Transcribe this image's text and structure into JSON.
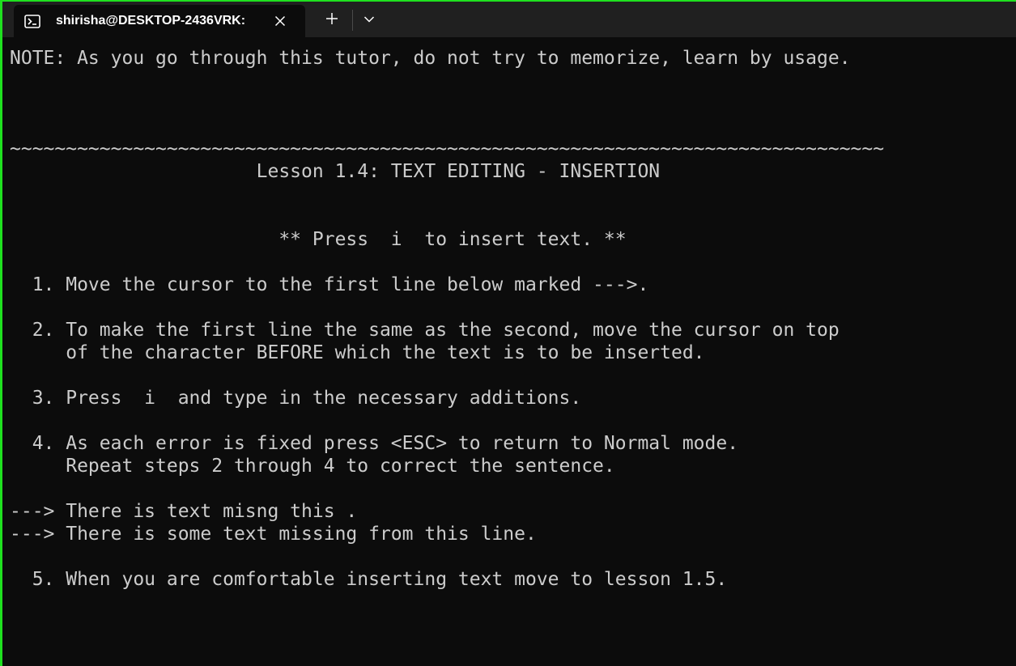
{
  "tab": {
    "title": "shirisha@DESKTOP-2436VRK:",
    "icon": "terminal-icon"
  },
  "controls": {
    "close_icon": "close-icon",
    "new_tab_icon": "plus-icon",
    "dropdown_icon": "chevron-down-icon"
  },
  "colors": {
    "background": "#0c0c0c",
    "tabbar": "#202020",
    "text": "#cccccc",
    "window_border": "#1fe01f"
  },
  "terminal": {
    "lines": [
      "NOTE: As you go through this tutor, do not try to memorize, learn by usage.",
      "",
      "",
      "",
      "~~~~~~~~~~~~~~~~~~~~~~~~~~~~~~~~~~~~~~~~~~~~~~~~~~~~~~~~~~~~~~~~~~~~~~~~~~~~~~",
      "                      Lesson 1.4: TEXT EDITING - INSERTION",
      "",
      "",
      "                        ** Press  i  to insert text. **",
      "",
      "  1. Move the cursor to the first line below marked --->.",
      "",
      "  2. To make the first line the same as the second, move the cursor on top",
      "     of the character BEFORE which the text is to be inserted.",
      "",
      "  3. Press  i  and type in the necessary additions.",
      "",
      "  4. As each error is fixed press <ESC> to return to Normal mode.",
      "     Repeat steps 2 through 4 to correct the sentence.",
      "",
      "---> There is text misng this .",
      "---> There is some text missing from this line.",
      "",
      "  5. When you are comfortable inserting text move to lesson 1.5.",
      "",
      "",
      ""
    ]
  }
}
